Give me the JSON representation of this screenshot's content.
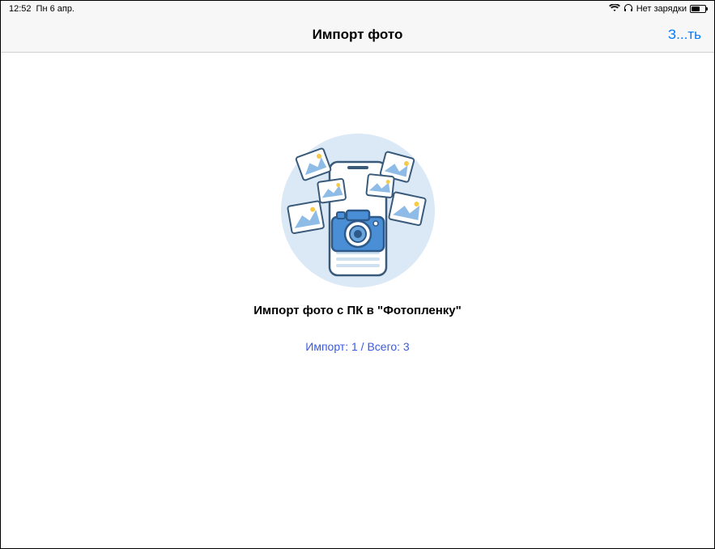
{
  "status_bar": {
    "time": "12:52",
    "date": "Пн 6 апр.",
    "charging_text": "Нет зарядки"
  },
  "nav": {
    "title": "Импорт фото",
    "right_action": "З...ть"
  },
  "main": {
    "title": "Импорт фото с ПК в \"Фотопленку\"",
    "status": "Импорт: 1 / Всего: 3"
  }
}
